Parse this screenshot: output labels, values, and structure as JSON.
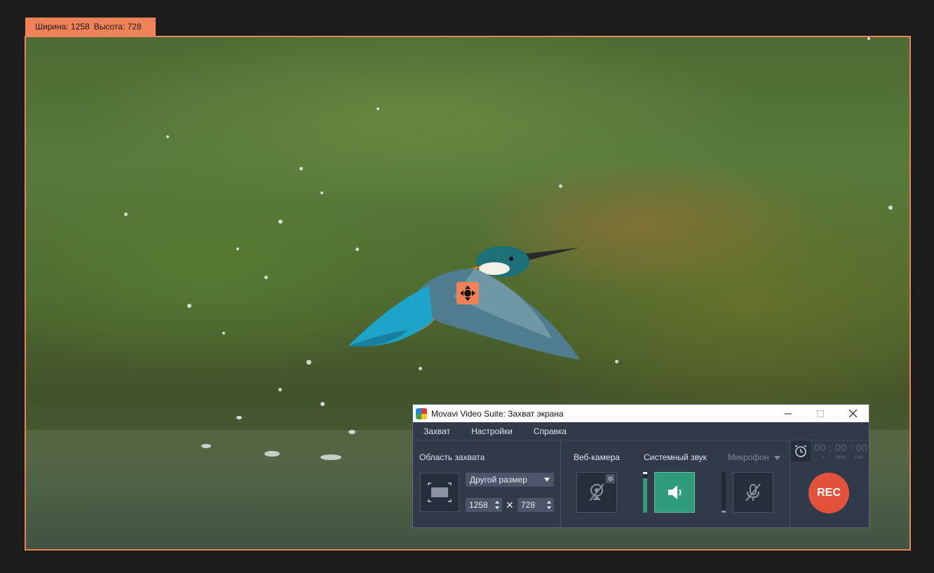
{
  "overlay": {
    "width_label": "Ширина: 1258",
    "height_label": "Высота: 728"
  },
  "window": {
    "title": "Movavi Video Suite: Захват экрана",
    "controls": [
      "minimize-icon",
      "maximize-icon",
      "close-icon"
    ]
  },
  "menu": {
    "items": [
      "Захват",
      "Настройки",
      "Справка"
    ]
  },
  "capture_area": {
    "label": "Область захвата",
    "preset": "Другой размер",
    "width": "1258",
    "height": "728",
    "times_symbol": "✕"
  },
  "devices": {
    "webcam_label": "Веб-камера",
    "system_audio_label": "Системный звук",
    "microphone_label": "Микрофон",
    "system_audio_level": 0.85,
    "microphone_level": 0.0
  },
  "recording": {
    "timer": "00 : 00 : 00",
    "units": [
      "ч",
      "мин",
      "сек"
    ],
    "rec_label": "REC"
  },
  "colors": {
    "accent": "#f0825a",
    "panel": "#323a4a",
    "active_green": "#2f9b7a",
    "rec_red": "#e2533e"
  }
}
